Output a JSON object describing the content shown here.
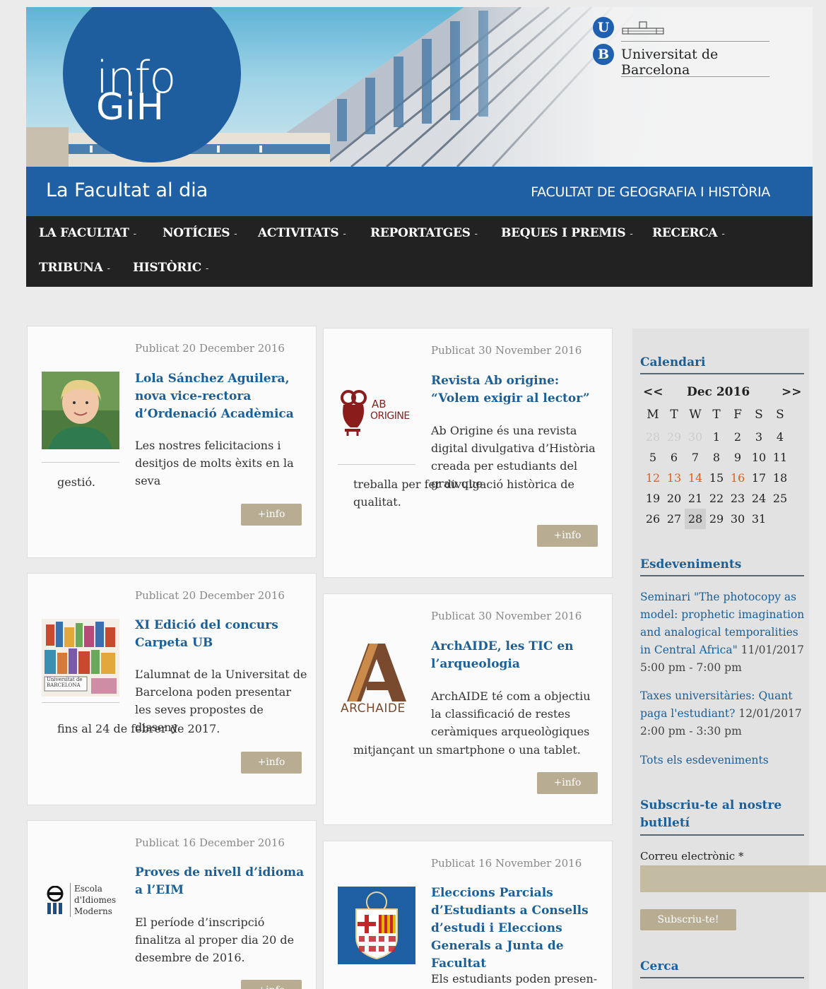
{
  "header": {
    "logo_line1": "info",
    "logo_line2": "GiH",
    "university_name": "Universitat de Barcelona",
    "ub_u": "U",
    "ub_b": "B"
  },
  "band": {
    "site_title": "La Facultat al dia",
    "faculty_name": "FACULTAT DE GEOGRAFIA I HISTÒRIA"
  },
  "nav": {
    "items": [
      "LA FACULTAT",
      "NOTÍCIES",
      "ACTIVITATS",
      "REPORTATGES",
      "BEQUES I PREMIS",
      "RECERCA",
      "TRIBUNA",
      "HISTÒRIC"
    ],
    "caret": "-"
  },
  "more_label": "+info",
  "cards": [
    {
      "date": "Publicat 20 December 2016",
      "title": "Lola Sánchez Aguilera, nova vice-rectora d’Ordenació Acadèmica",
      "excerpt": "Les nostres felicitacions i desitjos de molts èxits en la seva",
      "excerpt_tail": "gestió."
    },
    {
      "date": "Publicat 30 November 2016",
      "title": "Revista Ab origine: “Volem exigir al lector”",
      "excerpt": "Ab Origine és una revista digital divulgativa d’Història creada per estudiants del grau que",
      "excerpt_tail": "treballa per fer divulgació històrica de qualitat.",
      "logo_text_1": "AB",
      "logo_text_2": "ORIGINE"
    },
    {
      "date": "Publicat 20 December 2016",
      "title": "XI Edició del concurs Carpeta UB",
      "excerpt": "L’alumnat de la Universitat de Barcelona poden presentar les seves propostes de disseny",
      "excerpt_tail": "fins al 24 de febrer de 2017.",
      "thumb_text": "Universitat de BARCELONA"
    },
    {
      "date": "Publicat 30 November 2016",
      "title": "ArchAIDE, les TIC en l’arqueologia",
      "excerpt": "ArchAIDE té com a objectiu la classificació de restes ceràmiques arqueològiques",
      "excerpt_tail": "mitjançant un smartphone o una tablet.",
      "logo_text": "ARCHAIDE"
    },
    {
      "date": "Publicat 16 December 2016",
      "title": "Proves de nivell d’idioma a l’EIM",
      "excerpt": "El període d’inscripció finalitza al proper dia 20 de desembre de 2016.",
      "logo_line1": "Escola",
      "logo_line2": "d'Idiomes",
      "logo_line3": "Moderns"
    },
    {
      "date": "Publicat 16 November 2016",
      "title": "Eleccions Parcials d’Estudiants a Consells d’estudi i Eleccions Generals a Junta de Facultat",
      "excerpt": "Els estudiants poden presen-"
    }
  ],
  "sidebar": {
    "calendar_heading": "Calendari",
    "cal_prev": "<<",
    "cal_next": ">>",
    "cal_month": "Dec 2016",
    "weekdays": [
      "M",
      "T",
      "W",
      "T",
      "F",
      "S",
      "S"
    ],
    "weeks": [
      [
        "28",
        "29",
        "30",
        "1",
        "2",
        "3",
        "4"
      ],
      [
        "5",
        "6",
        "7",
        "8",
        "9",
        "10",
        "11"
      ],
      [
        "12",
        "13",
        "14",
        "15",
        "16",
        "17",
        "18"
      ],
      [
        "19",
        "20",
        "21",
        "22",
        "23",
        "24",
        "25"
      ],
      [
        "26",
        "27",
        "28",
        "29",
        "30",
        "31",
        ""
      ]
    ],
    "events_heading": "Esdeveniments",
    "events": [
      {
        "title": "Seminari \"The photocopy as model: prophetic imagination and analogical temporalities in Central Africa\"",
        "date": "11/01/2017",
        "time": "5:00 pm - 7:00 pm"
      },
      {
        "title": "Taxes universitàries: Quant paga l'estudiant?",
        "date": "12/01/2017",
        "time": "2:00 pm - 3:30 pm"
      }
    ],
    "all_events": "Tots els esdeveniments",
    "newsletter_heading": "Subscriu-te al nostre butlletí",
    "email_label": "Correu electrònic *",
    "email_value": "",
    "subscribe_label": "Subscriu-te!",
    "search_heading": "Cerca"
  },
  "colors": {
    "brand_blue": "#1f5fa4",
    "nav_bg": "#222222",
    "link_blue": "#1b5f98",
    "button_tan": "#b8ad93",
    "event_orange": "#e0601a"
  }
}
